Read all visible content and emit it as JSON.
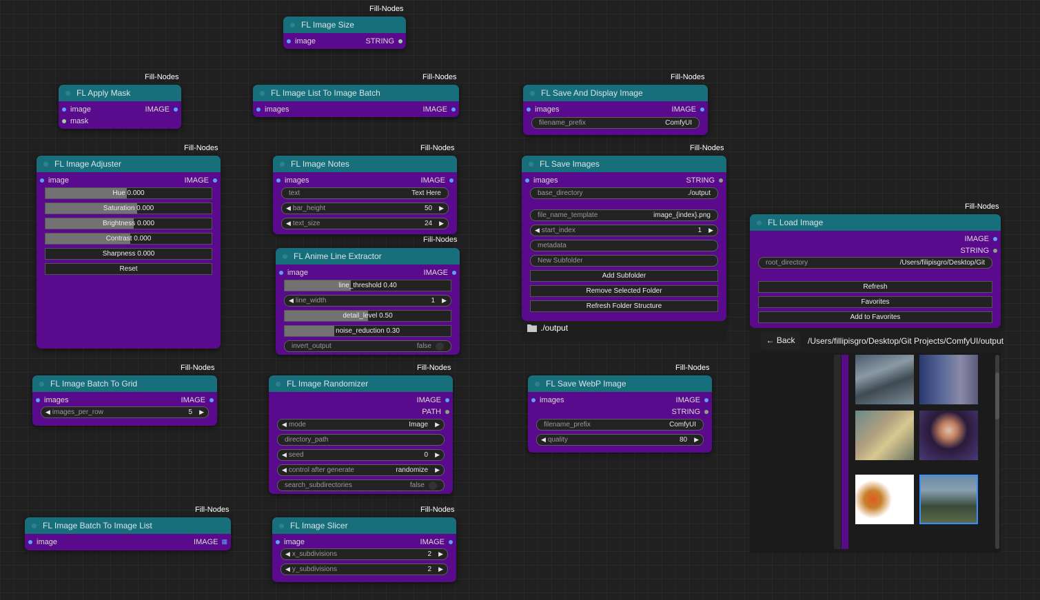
{
  "badge": "Fill-Nodes",
  "nodes": {
    "image_size": {
      "title": "FL Image Size",
      "in": "image",
      "out": "STRING"
    },
    "apply_mask": {
      "title": "FL Apply Mask",
      "in1": "image",
      "in2": "mask",
      "out": "IMAGE"
    },
    "list_to_batch": {
      "title": "FL Image List To Image Batch",
      "in": "images",
      "out": "IMAGE"
    },
    "save_display": {
      "title": "FL Save And Display Image",
      "in": "images",
      "out": "IMAGE",
      "w_label": "filename_prefix",
      "w_value": "ComfyUI"
    },
    "adjuster": {
      "title": "FL Image Adjuster",
      "in": "image",
      "out": "IMAGE",
      "sliders": [
        {
          "label": "Hue",
          "value": "0.000",
          "fill": 0.49
        },
        {
          "label": "Saturation",
          "value": "0.000",
          "fill": 0.55
        },
        {
          "label": "Brightness",
          "value": "0.000",
          "fill": 0.53
        },
        {
          "label": "Contrast",
          "value": "0.000",
          "fill": 0.51
        },
        {
          "label": "Sharpness",
          "value": "0.000",
          "fill": 0.0
        }
      ],
      "reset": "Reset"
    },
    "notes": {
      "title": "FL Image Notes",
      "in": "images",
      "out": "IMAGE",
      "text_label": "text",
      "text_value": "Text Here",
      "bar_label": "bar_height",
      "bar_value": "50",
      "size_label": "text_size",
      "size_value": "24"
    },
    "anime": {
      "title": "FL Anime Line Extractor",
      "in": "image",
      "out": "IMAGE",
      "threshold": {
        "label": "line_threshold",
        "value": "0.40",
        "fill": 0.4
      },
      "width_label": "line_width",
      "width_value": "1",
      "detail": {
        "label": "detail_level",
        "value": "0.50",
        "fill": 0.5
      },
      "noise": {
        "label": "noise_reduction",
        "value": "0.30",
        "fill": 0.3
      },
      "invert_label": "invert_output",
      "invert_value": "false"
    },
    "save_images": {
      "title": "FL Save Images",
      "in": "images",
      "out": "STRING",
      "base_label": "base_directory",
      "base_value": "./output",
      "tmpl_label": "file_name_template",
      "tmpl_value": "image_{index}.png",
      "start_label": "start_index",
      "start_value": "1",
      "metadata": "metadata",
      "subfolder": "New Subfolder",
      "add": "Add Subfolder",
      "remove": "Remove Selected Folder",
      "refresh": "Refresh Folder Structure",
      "folder": "./output"
    },
    "load_image": {
      "title": "FL Load Image",
      "out1": "IMAGE",
      "out2": "STRING",
      "root_label": "root_directory",
      "root_value": "/Users/filipisgro/Desktop/Git",
      "refresh": "Refresh",
      "favorites": "Favorites",
      "add_fav": "Add to Favorites",
      "back": "← Back",
      "path": "/Users/fillipisgro/Desktop/Git Projects/ComfyUI/output"
    },
    "batch_grid": {
      "title": "FL Image Batch To Grid",
      "in": "images",
      "out": "IMAGE",
      "w_label": "images_per_row",
      "w_value": "5"
    },
    "randomizer": {
      "title": "FL Image Randomizer",
      "out1": "IMAGE",
      "out2": "PATH",
      "mode_label": "mode",
      "mode_value": "Image",
      "dir_label": "directory_path",
      "seed_label": "seed",
      "seed_value": "0",
      "ctrl_label": "control after generate",
      "ctrl_value": "randomize",
      "sub_label": "search_subdirectories",
      "sub_value": "false"
    },
    "webp": {
      "title": "FL Save WebP Image",
      "in": "images",
      "out1": "IMAGE",
      "out2": "STRING",
      "prefix_label": "filename_prefix",
      "prefix_value": "ComfyUI",
      "quality_label": "quality",
      "quality_value": "80"
    },
    "batch_list": {
      "title": "FL Image Batch To Image List",
      "in": "image",
      "out": "IMAGE"
    },
    "slicer": {
      "title": "FL Image Slicer",
      "in": "image",
      "out": "IMAGE",
      "x_label": "x_subdivisions",
      "x_value": "2",
      "y_label": "y_subdivisions",
      "y_value": "2"
    }
  }
}
